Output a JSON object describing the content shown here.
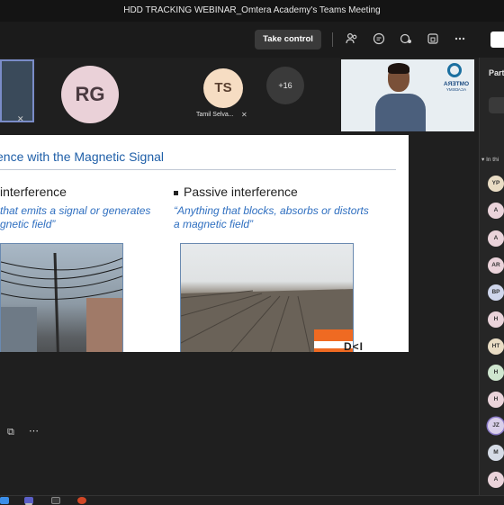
{
  "window": {
    "title": "HDD TRACKING WEBINAR_Omtera Academy's Teams Meeting"
  },
  "toolbar": {
    "take_control_label": "Take control",
    "icons": [
      "people-icon",
      "chat-icon",
      "reactions-icon",
      "rooms-icon",
      "more-icon",
      "camera-icon"
    ]
  },
  "gallery": {
    "tiles": [
      {
        "initials": "RG",
        "color": "#ead1d8"
      },
      {
        "initials": "TS",
        "name": "Tamil Selva...",
        "color": "#f6ddc3"
      },
      {
        "overflow_label": "+16"
      }
    ],
    "video_logo": {
      "text": "OMTERA",
      "sub": "ACADEMY"
    }
  },
  "slide": {
    "title": "ence with the Magnetic Signal",
    "left_heading": "interference",
    "left_quote": "that emits a signal or generates\ngnetic field”",
    "right_heading": "Passive interference",
    "right_quote": "“Anything that blocks, absorbs or distorts\na magnetic field”",
    "brand": "D<I"
  },
  "panel": {
    "title": "Part",
    "section": "In thi",
    "participants": [
      {
        "initials": "YP",
        "color": "#e9dcc4"
      },
      {
        "initials": "A",
        "color": "#ead3da"
      },
      {
        "initials": "A",
        "color": "#ead3da"
      },
      {
        "initials": "AR",
        "color": "#ead3da"
      },
      {
        "initials": "BP",
        "color": "#cfd6ec"
      },
      {
        "initials": "H",
        "color": "#ead3da"
      },
      {
        "initials": "HT",
        "color": "#e9dcc4"
      },
      {
        "initials": "H",
        "color": "#cfe6cf"
      },
      {
        "initials": "H",
        "color": "#ead3da"
      },
      {
        "initials": "JZ",
        "color": "#d9cfea"
      },
      {
        "initials": "M",
        "color": "#d5dbe6"
      },
      {
        "initials": "A",
        "color": "#ead3da"
      }
    ]
  },
  "taskbar": {
    "apps": [
      {
        "icon": "windows-start-icon",
        "color": "#3b8ee8"
      },
      {
        "icon": "teams-icon",
        "color": "#5b5fc7"
      },
      {
        "icon": "security-icon",
        "color": "#3a3a3a"
      },
      {
        "icon": "powerpoint-icon",
        "color": "#d24726"
      }
    ]
  }
}
